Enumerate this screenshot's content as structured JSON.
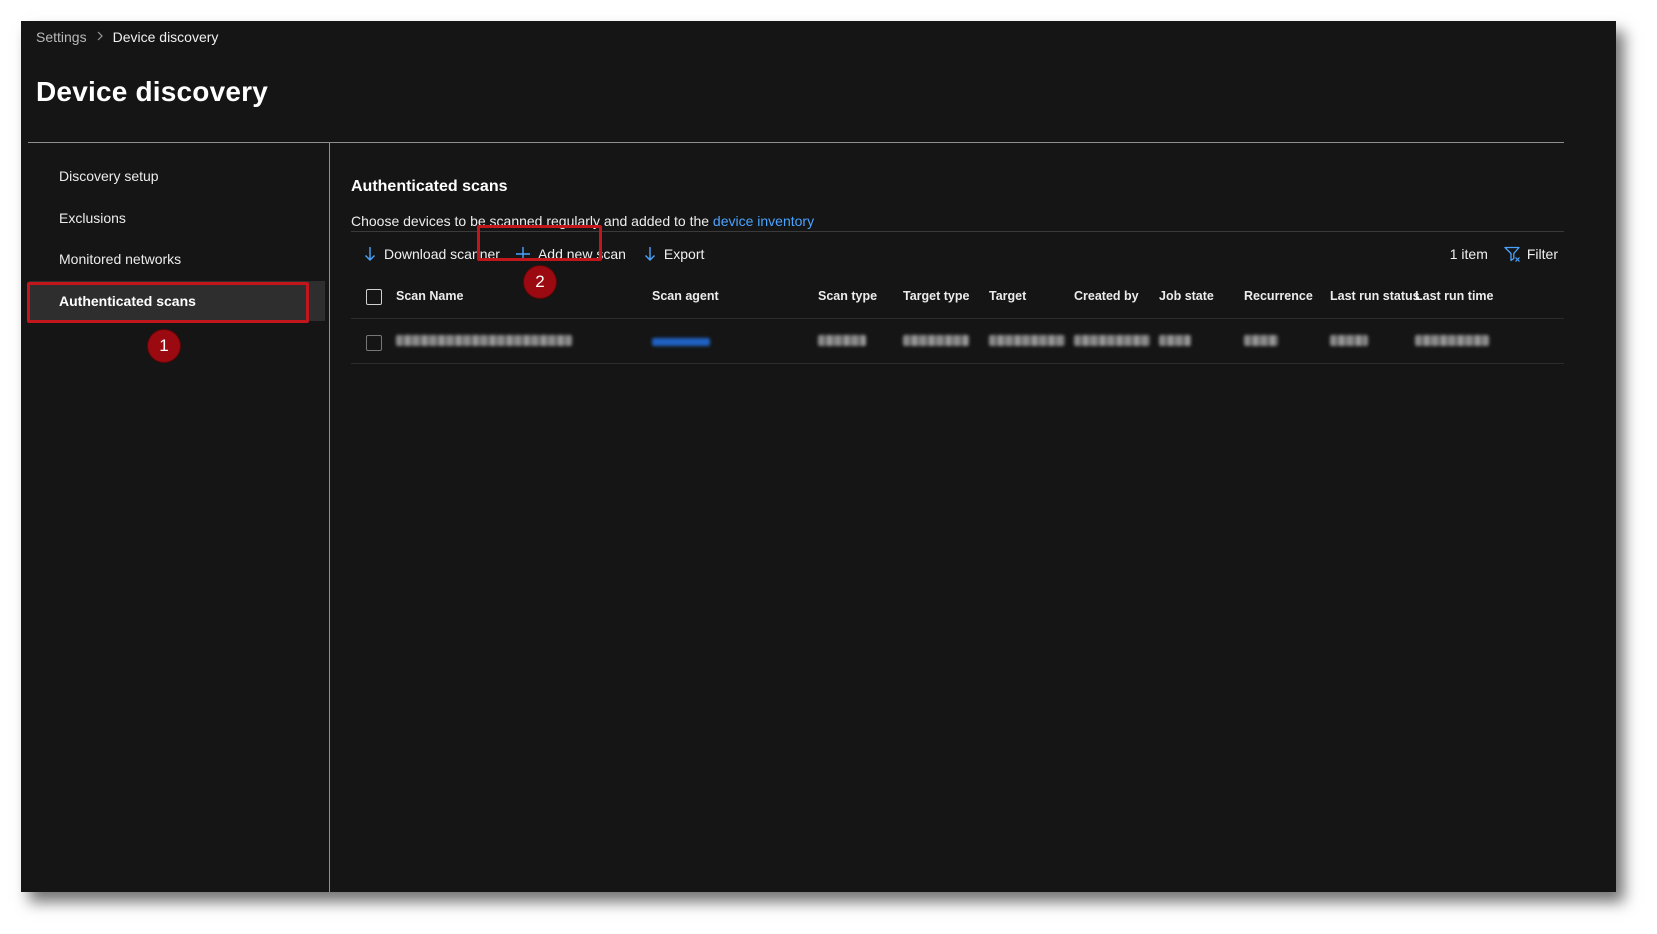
{
  "breadcrumb": {
    "root": "Settings",
    "separator": ">",
    "current": "Device discovery"
  },
  "page_title": "Device discovery",
  "sidebar": {
    "items": [
      {
        "label": "Discovery setup",
        "active": false
      },
      {
        "label": "Exclusions",
        "active": false
      },
      {
        "label": "Monitored networks",
        "active": false
      },
      {
        "label": "Authenticated scans",
        "active": true
      }
    ]
  },
  "callouts": {
    "one": "1",
    "two": "2",
    "color": "#c0161c"
  },
  "main": {
    "section_title": "Authenticated scans",
    "description_prefix": "Choose devices to be scanned regularly and added to the ",
    "description_link": "device inventory",
    "toolbar": {
      "download_scanner": "Download scanner",
      "add_new_scan": "Add new scan",
      "export": "Export",
      "item_count": "1 item",
      "filter": "Filter"
    },
    "table": {
      "columns": [
        "Scan Name",
        "Scan agent",
        "Scan type",
        "Target type",
        "Target",
        "Created by",
        "Job state",
        "Recurrence",
        "Last run status",
        "Last run time"
      ],
      "rows": [
        {
          "obscured": true
        }
      ]
    }
  },
  "colors": {
    "accent": "#4aa3ff",
    "background": "#151515",
    "callout": "#c0161c"
  },
  "icons": [
    "chevron-right-icon",
    "download-icon",
    "plus-icon",
    "filter-icon"
  ]
}
